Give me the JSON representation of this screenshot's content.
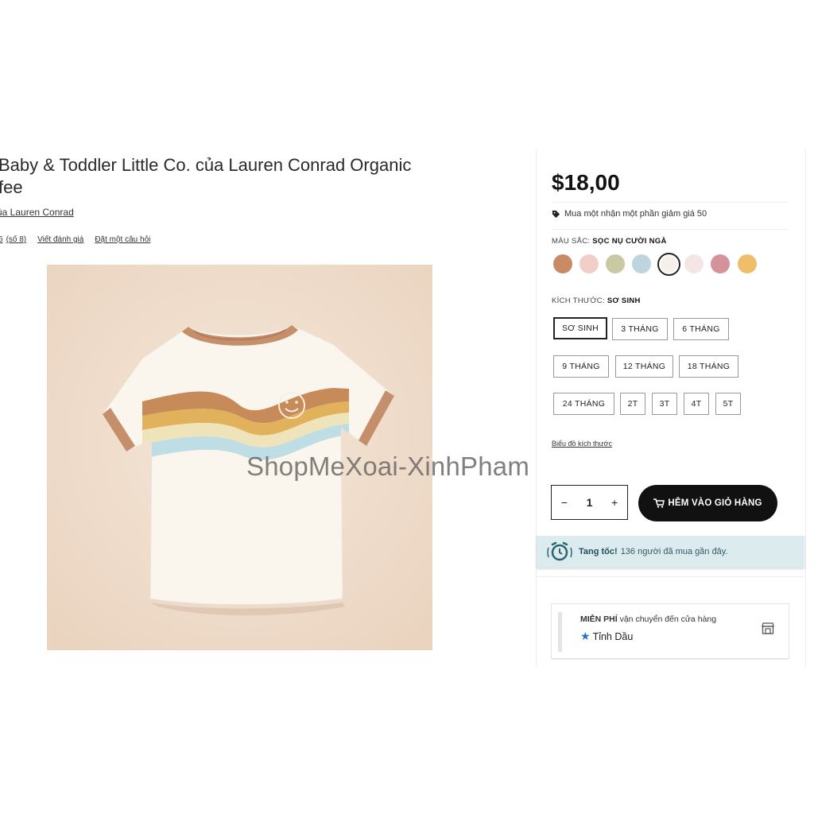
{
  "product": {
    "title": "Baby & Toddler Little Co. của Lauren Conrad Organic\nfee",
    "brand": "ủa Lauren Conrad",
    "rating_text": "6",
    "rating_count": "(số 8)",
    "write_review": "Viết đánh giá",
    "ask_question": "Đặt một câu hỏi",
    "watermark": "ShopMeXoai-XinhPham"
  },
  "buybox": {
    "price": "$18,00",
    "offer": "Mua một nhận một phần giảm giá 50",
    "color_label": "MÀU SẮC:",
    "color_value": "SỌC NỤ CƯỜI NGÀ",
    "size_label": "KÍCH THƯỚC:",
    "size_value": "SƠ SINH",
    "sizes": [
      "SƠ SINH",
      "3 THÁNG",
      "6 THÁNG",
      "9 THÁNG",
      "12 THÁNG",
      "18 THÁNG",
      "24 THÁNG",
      "2T",
      "3T",
      "4T",
      "5T"
    ],
    "size_chart": "Biểu đồ kích thước",
    "qty_minus": "−",
    "qty_value": "1",
    "qty_plus": "+",
    "add_to_cart": "HÊM VÀO GIỎ HÀNG",
    "promo_bold": "Tang tốc!",
    "promo_text": "136 người đã mua gần đây.",
    "ship_bold": "MIỄN PHÍ",
    "ship_text": "vận chuyển đến cửa hàng",
    "ship_store": "Tỉnh Dầu"
  },
  "colors": {
    "swatches": [
      "#c98a66",
      "#f1cfc8",
      "#c9c9a4",
      "#bcd5df",
      "#f6f1e8",
      "#f3e6e4",
      "#d4929a",
      "#efbe6a"
    ],
    "promo_bg": "#dcecee",
    "photo_bg": "#f1e0d0"
  }
}
